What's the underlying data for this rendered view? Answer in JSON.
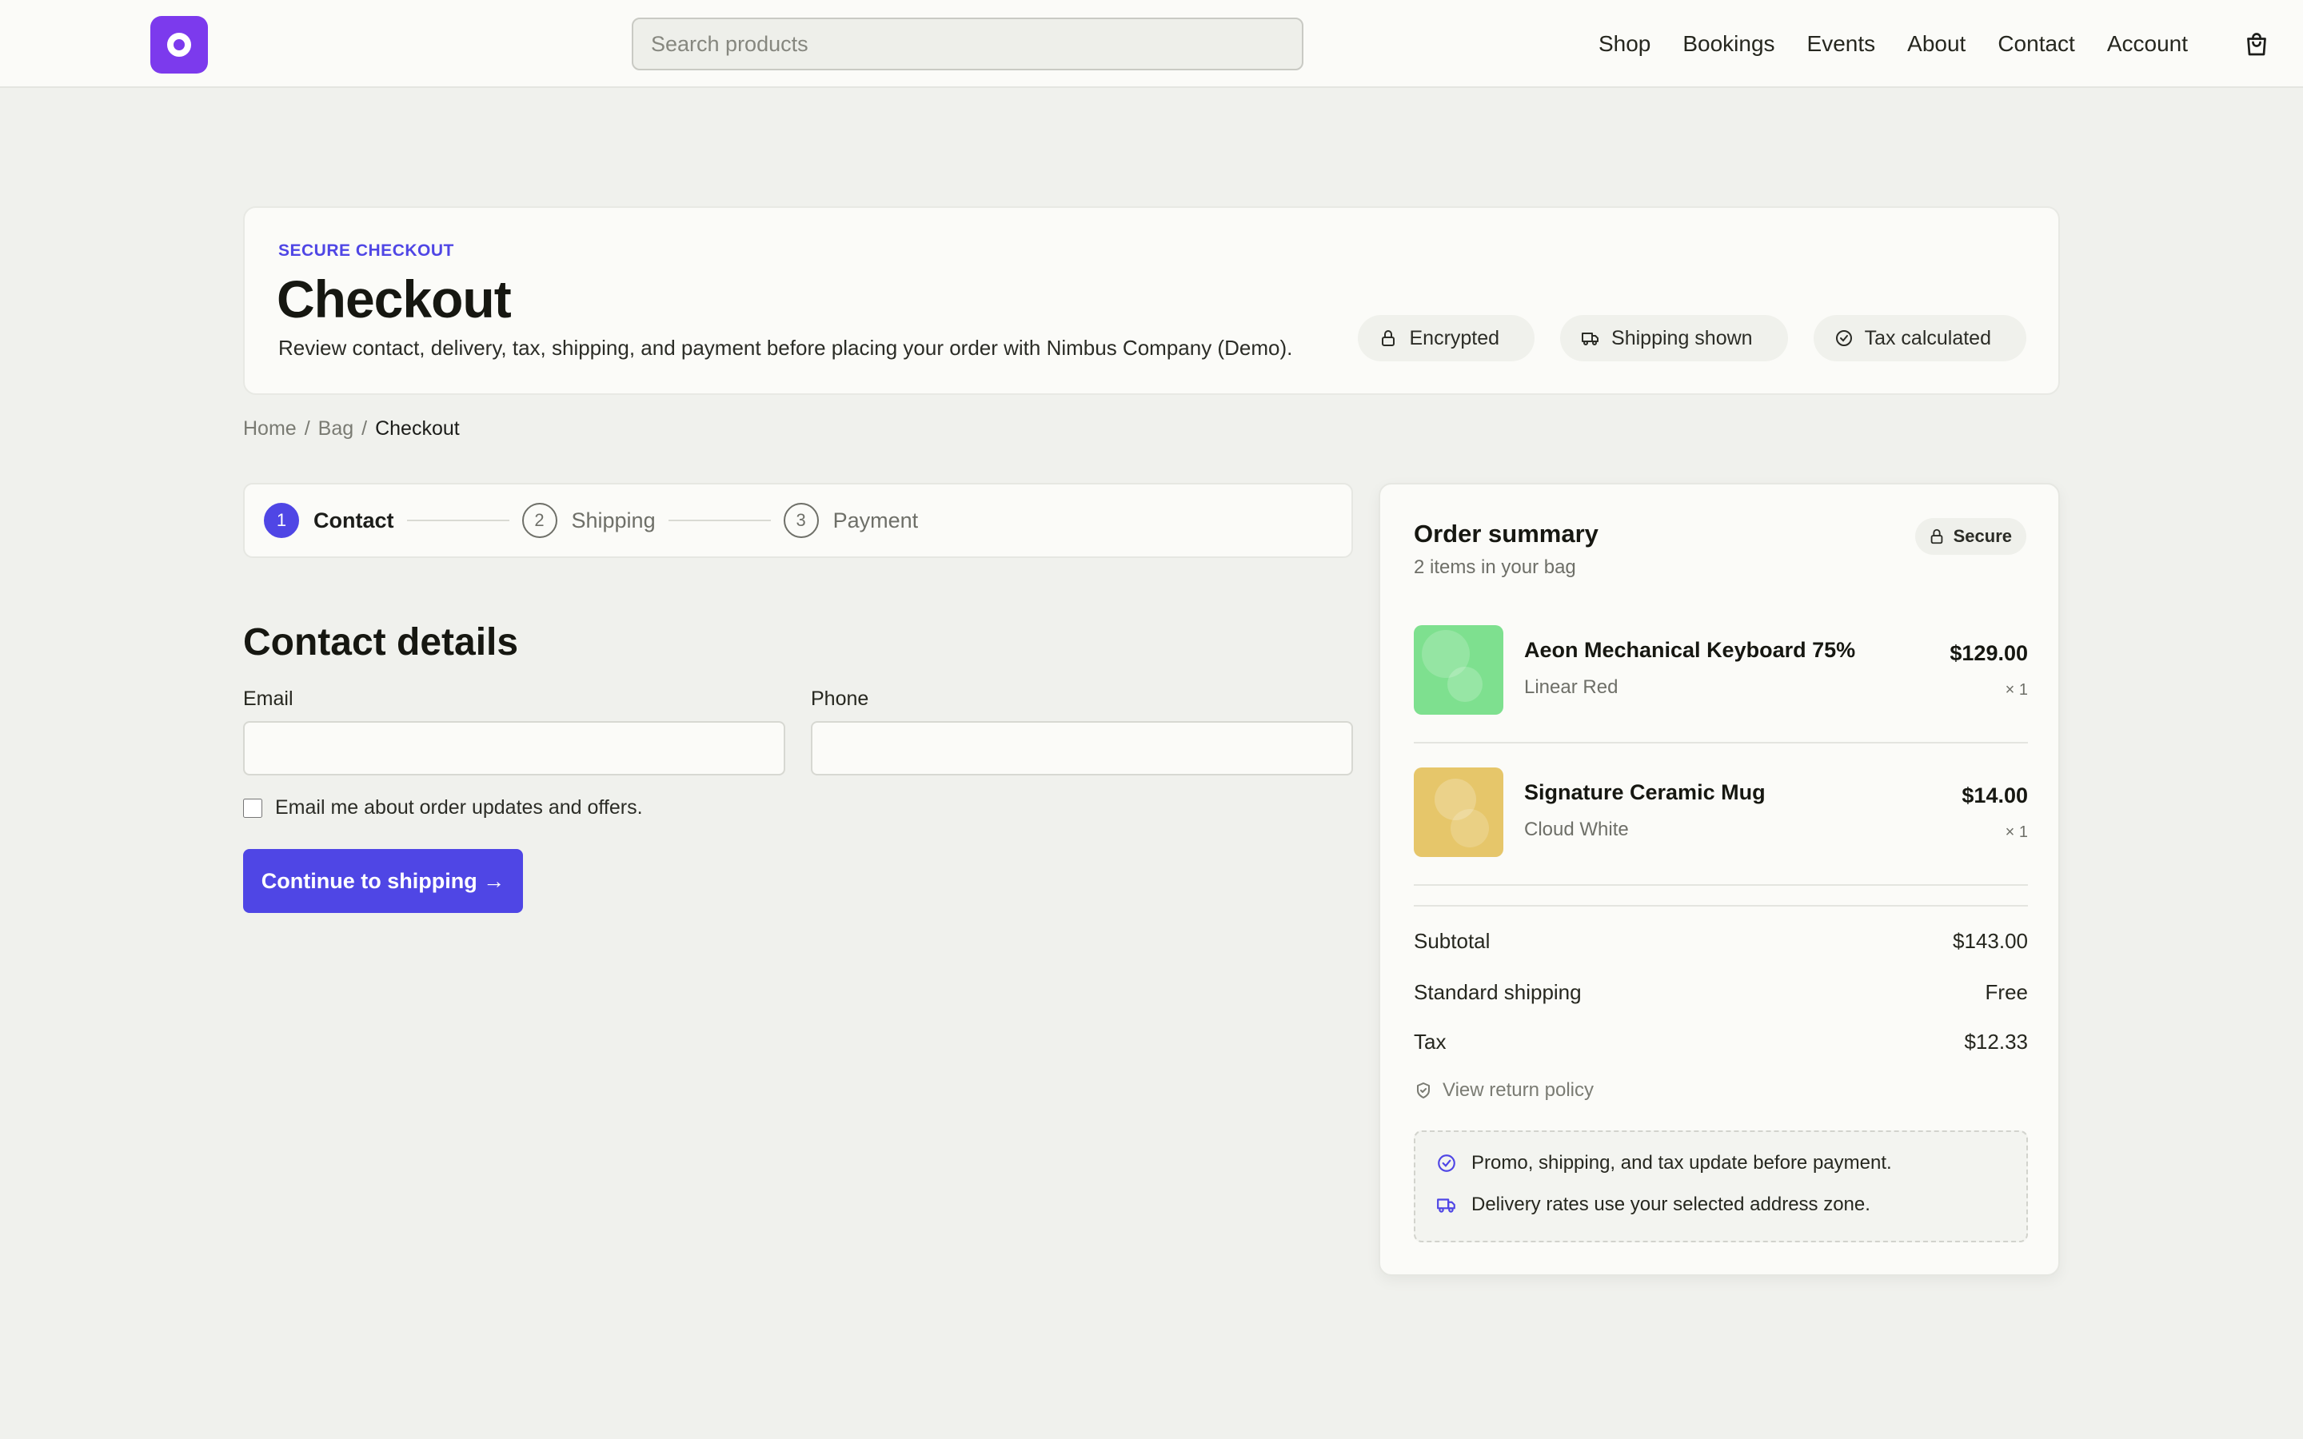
{
  "header": {
    "search_placeholder": "Search products",
    "nav": [
      "Shop",
      "Bookings",
      "Events",
      "About",
      "Contact",
      "Account"
    ]
  },
  "hero": {
    "eyebrow": "SECURE CHECKOUT",
    "title": "Checkout",
    "subtitle": "Review contact, delivery, tax, shipping, and payment before placing your order with Nimbus Company (Demo).",
    "chips": [
      {
        "label": "Encrypted",
        "icon": "lock-icon"
      },
      {
        "label": "Shipping shown",
        "icon": "truck-icon"
      },
      {
        "label": "Tax calculated",
        "icon": "check-circle-icon"
      }
    ]
  },
  "breadcrumb": {
    "home": "Home",
    "bag": "Bag",
    "current": "Checkout",
    "separator": "/"
  },
  "stepper": [
    {
      "num": "1",
      "label": "Contact",
      "active": true
    },
    {
      "num": "2",
      "label": "Shipping",
      "active": false
    },
    {
      "num": "3",
      "label": "Payment",
      "active": false
    }
  ],
  "contact": {
    "title": "Contact details",
    "email_label": "Email",
    "email_value": "",
    "phone_label": "Phone",
    "phone_value": "",
    "opt_in_label": "Email me about order updates and offers.",
    "opt_in_checked": false,
    "cta_label": "Continue to shipping →"
  },
  "summary": {
    "title": "Order summary",
    "subtitle": "2 items in your bag",
    "secure_label": "Secure",
    "items": [
      {
        "name": "Aeon Mechanical Keyboard 75%",
        "variant": "Linear Red",
        "price": "$129.00",
        "qty": "× 1",
        "color": "#7ee08f"
      },
      {
        "name": "Signature Ceramic Mug",
        "variant": "Cloud White",
        "price": "$14.00",
        "qty": "× 1",
        "color": "#e6c66a"
      }
    ],
    "subtotal_label": "Subtotal",
    "subtotal_value": "$143.00",
    "shipping_label": "Standard shipping",
    "shipping_value": "Free",
    "tax_label": "Tax",
    "tax_value": "$12.33",
    "policy_label": "View return policy",
    "notes": [
      "Promo, shipping, and tax update before payment.",
      "Delivery rates use your selected address zone."
    ]
  },
  "colors": {
    "accent": "#4f46e5",
    "logo": "#7c3aed",
    "background": "#f0f1ed"
  }
}
